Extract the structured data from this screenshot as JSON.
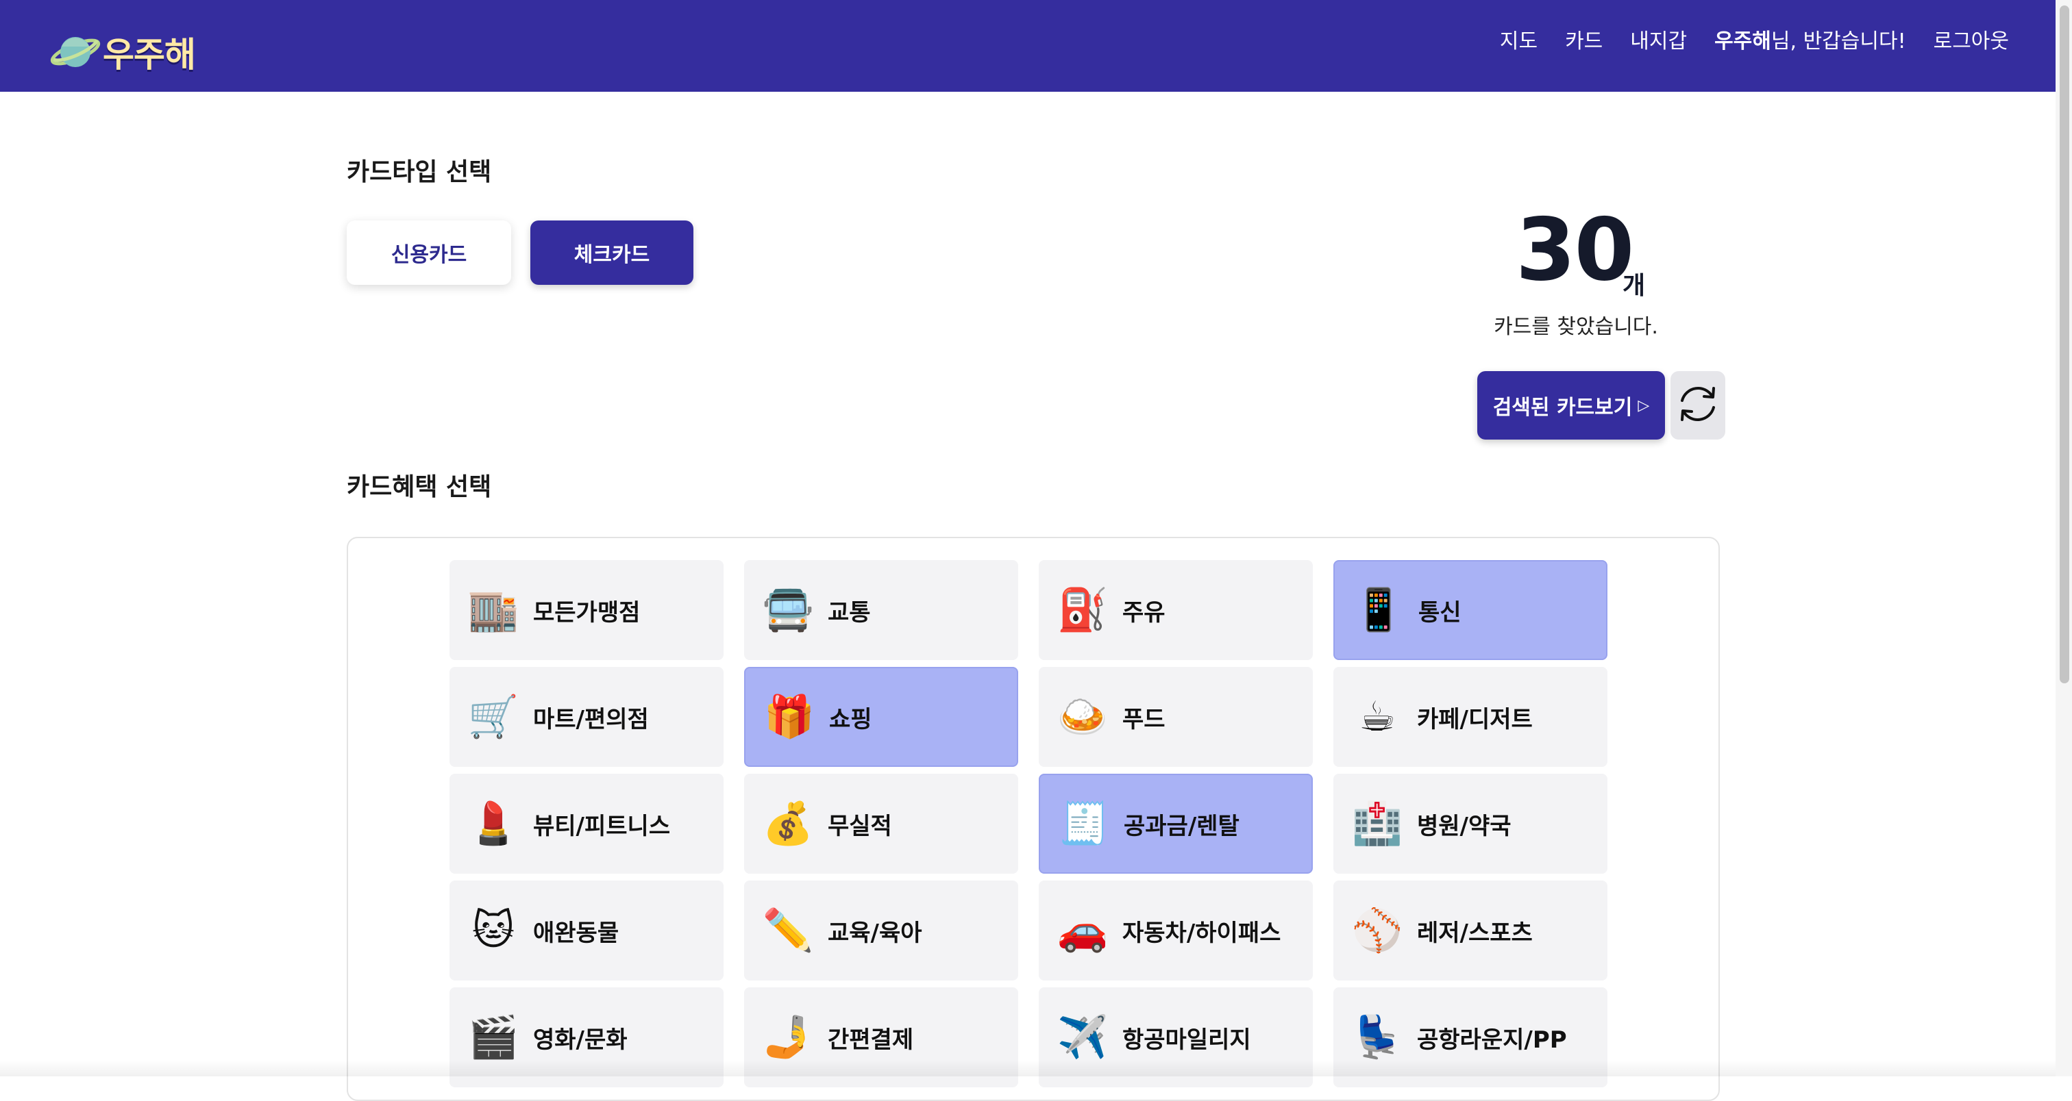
{
  "app": {
    "logo_text": "우주해",
    "logo_icon": "planet-icon"
  },
  "nav": {
    "map": "지도",
    "card": "카드",
    "wallet": "내지갑",
    "user_name": "우주해",
    "greeting_suffix": "님, 반갑습니다!",
    "logout": "로그아웃"
  },
  "card_type": {
    "title": "카드타입 선택",
    "credit_label": "신용카드",
    "check_label": "체크카드",
    "selected": "체크카드"
  },
  "result": {
    "count": "30",
    "unit": "개",
    "found_text": "카드를 찾았습니다.",
    "view_button": "검색된 카드보기",
    "view_button_arrow": "▷",
    "reset_icon": "refresh-icon"
  },
  "benefits": {
    "title": "카드혜택 선택",
    "items": [
      {
        "label": "모든가맹점",
        "icon": "🏬",
        "icon_name": "department-store-icon",
        "selected": false
      },
      {
        "label": "교통",
        "icon": "🚍",
        "icon_name": "bus-icon",
        "selected": false
      },
      {
        "label": "주유",
        "icon": "⛽",
        "icon_name": "fuel-pump-icon",
        "selected": false
      },
      {
        "label": "통신",
        "icon": "📱",
        "icon_name": "mobile-phone-icon",
        "selected": true
      },
      {
        "label": "마트/편의점",
        "icon": "🛒",
        "icon_name": "shopping-cart-icon",
        "selected": false
      },
      {
        "label": "쇼핑",
        "icon": "🎁",
        "icon_name": "gift-icon",
        "selected": true
      },
      {
        "label": "푸드",
        "icon": "🍛",
        "icon_name": "curry-rice-icon",
        "selected": false
      },
      {
        "label": "카페/디저트",
        "icon": "☕",
        "icon_name": "coffee-icon",
        "selected": false
      },
      {
        "label": "뷰티/피트니스",
        "icon": "💄",
        "icon_name": "lipstick-icon",
        "selected": false
      },
      {
        "label": "무실적",
        "icon": "💰",
        "icon_name": "money-bag-icon",
        "selected": false
      },
      {
        "label": "공과금/렌탈",
        "icon": "🧾",
        "icon_name": "receipt-icon",
        "selected": true
      },
      {
        "label": "병원/약국",
        "icon": "🏥",
        "icon_name": "hospital-icon",
        "selected": false
      },
      {
        "label": "애완동물",
        "icon": "🐱",
        "icon_name": "cat-icon",
        "selected": false
      },
      {
        "label": "교육/육아",
        "icon": "✏️",
        "icon_name": "pencil-icon",
        "selected": false
      },
      {
        "label": "자동차/하이패스",
        "icon": "🚗",
        "icon_name": "car-icon",
        "selected": false
      },
      {
        "label": "레저/스포츠",
        "icon": "⚾",
        "icon_name": "baseball-icon",
        "selected": false
      },
      {
        "label": "영화/문화",
        "icon": "🎬",
        "icon_name": "clapper-board-icon",
        "selected": false
      },
      {
        "label": "간편결제",
        "icon": "🤳",
        "icon_name": "selfie-phone-icon",
        "selected": false
      },
      {
        "label": "항공마일리지",
        "icon": "✈️",
        "icon_name": "airplane-icon",
        "selected": false
      },
      {
        "label": "공항라운지/PP",
        "icon": "💺",
        "icon_name": "seat-icon",
        "selected": false
      }
    ]
  },
  "colors": {
    "primary": "#352d9e",
    "selected_benefit": "#a9b2f5",
    "benefit_bg": "#f3f3f5",
    "logo_text": "#ffe9a6"
  }
}
